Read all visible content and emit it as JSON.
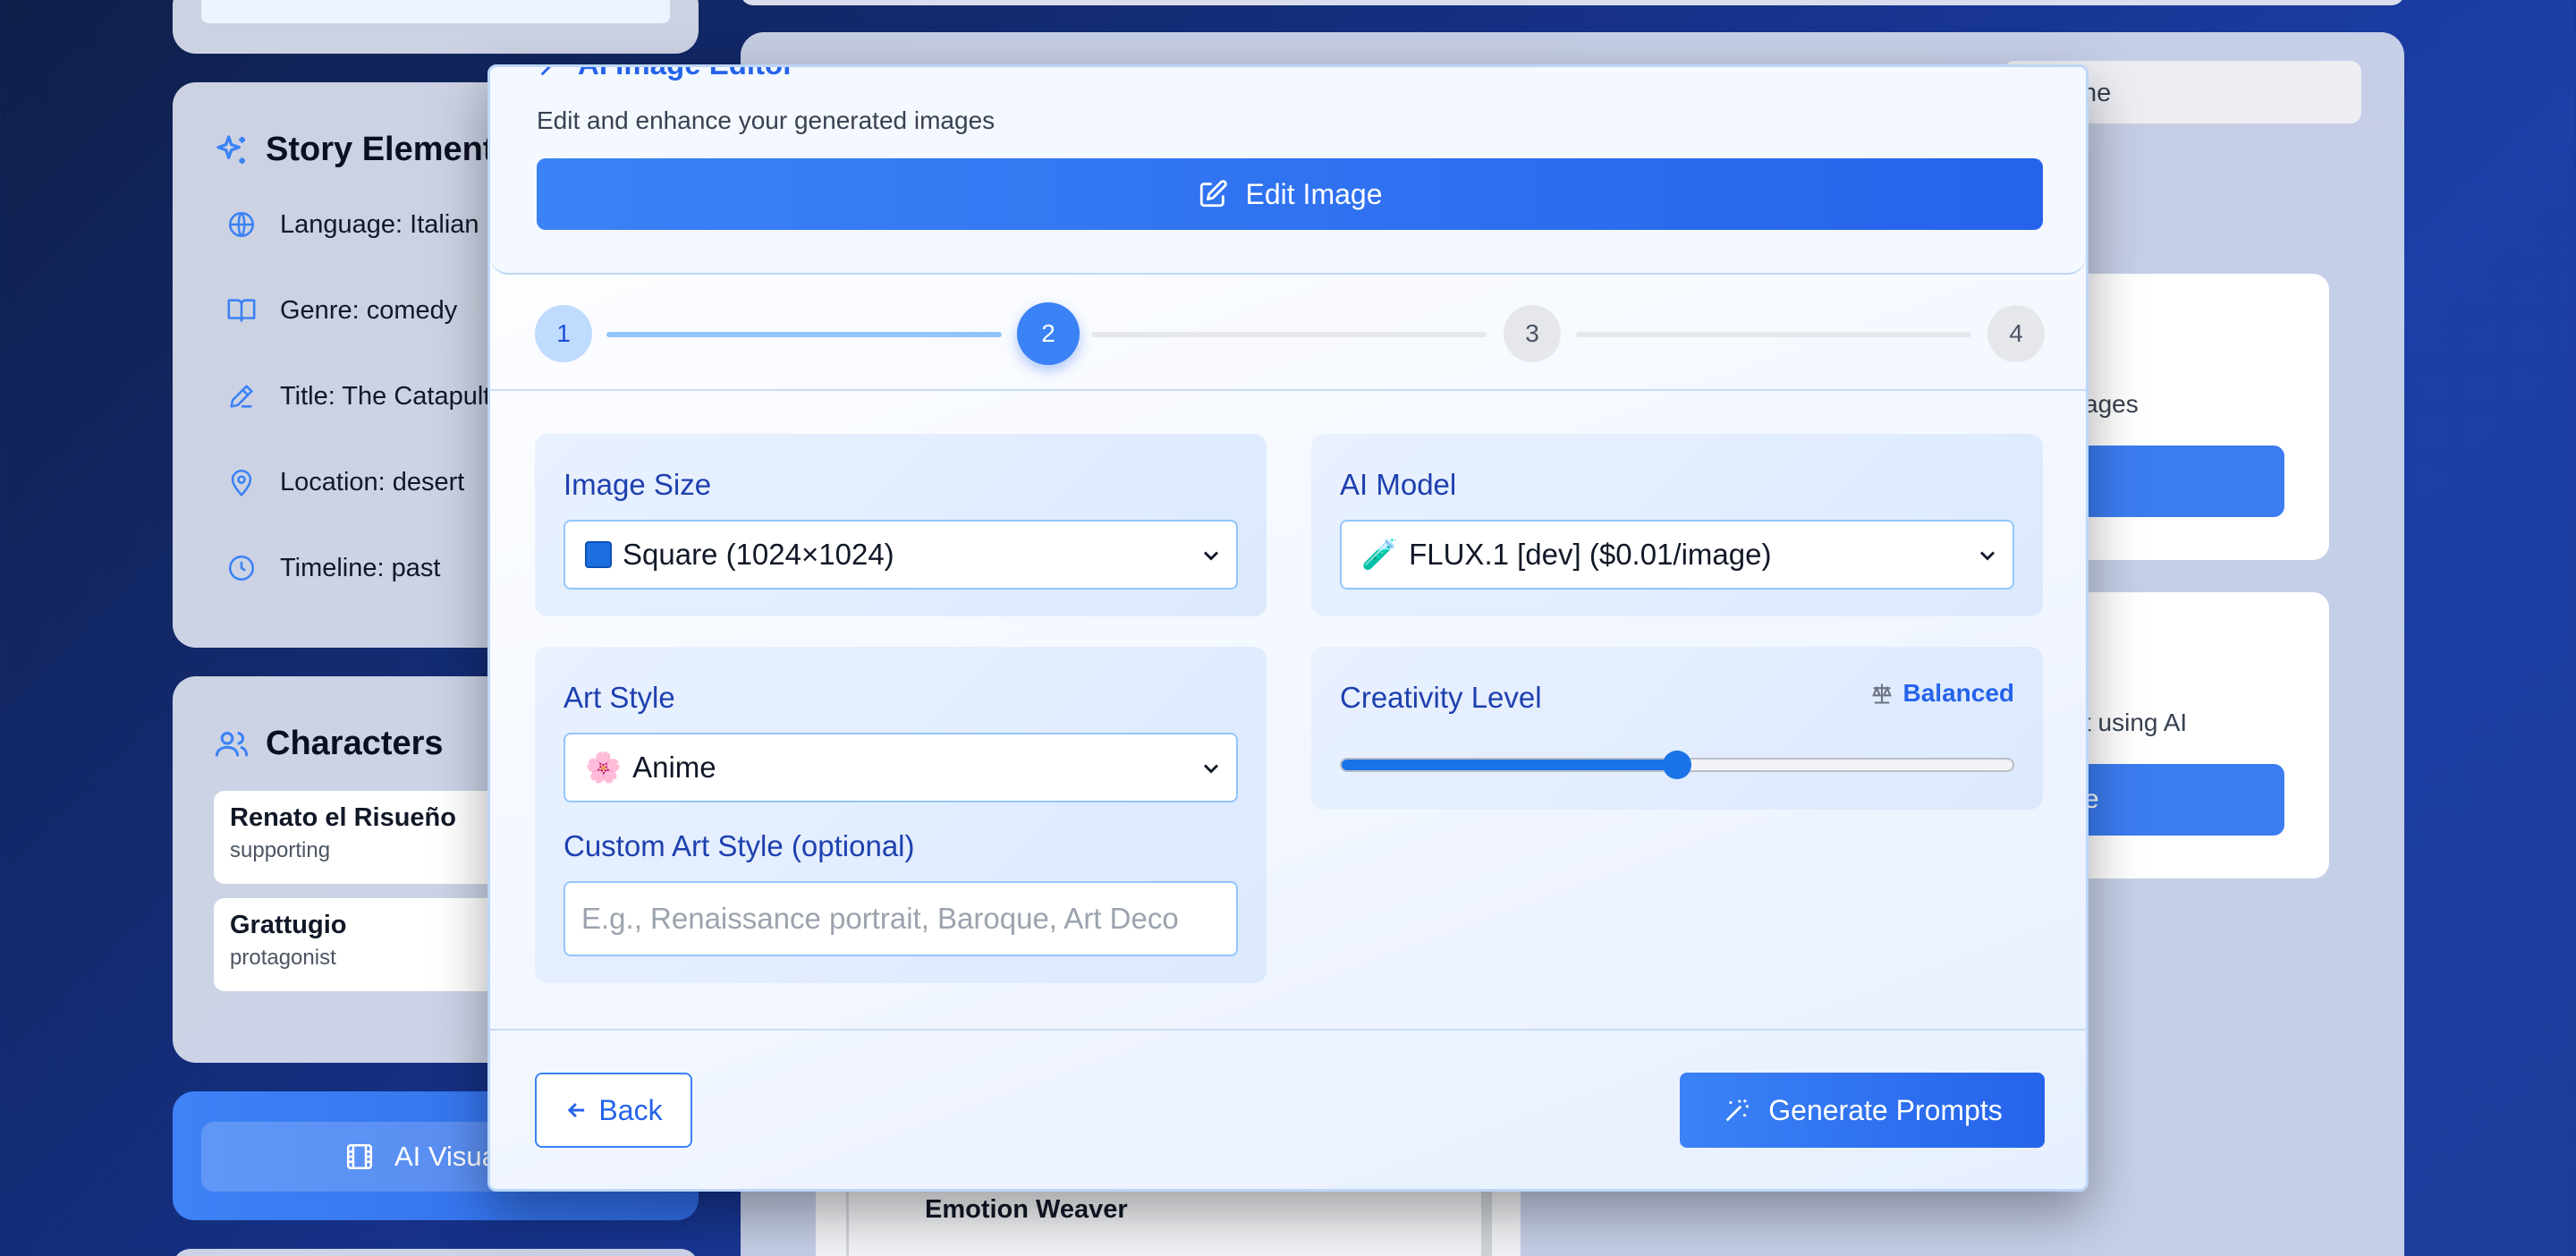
{
  "story_elements": {
    "title": "Story Elements",
    "items": [
      {
        "label": "Language: Italian"
      },
      {
        "label": "Genre: comedy"
      },
      {
        "label": "Title: The Catapult"
      },
      {
        "label": "Location: desert"
      },
      {
        "label": "Timeline: past"
      }
    ]
  },
  "characters": {
    "title": "Characters",
    "items": [
      {
        "name": "Renato el Risueño",
        "role": "supporting"
      },
      {
        "name": "Grattugio",
        "role": "protagonist"
      }
    ]
  },
  "ai_visual": {
    "label": "AI Visual S"
  },
  "background": {
    "tab_partial": "ne",
    "card1_desc": "ages",
    "card2_desc": "t using AI",
    "card2_btn": "e",
    "emotion_label": "Emotion Weaver"
  },
  "modal": {
    "title": "AI Image Editor",
    "subtitle": "Edit and enhance your generated images",
    "edit_button": "Edit Image",
    "steps": [
      {
        "number": "1",
        "state": "done"
      },
      {
        "number": "2",
        "state": "active"
      },
      {
        "number": "3",
        "state": "todo"
      },
      {
        "number": "4",
        "state": "todo"
      }
    ],
    "image_size": {
      "label": "Image Size",
      "value": "Square (1024×1024)"
    },
    "ai_model": {
      "label": "AI Model",
      "icon": "🧪",
      "value": "FLUX.1 [dev] ($0.01/image)"
    },
    "art_style": {
      "label": "Art Style",
      "icon": "🌸",
      "value": "Anime"
    },
    "custom_art_style": {
      "label": "Custom Art Style (optional)",
      "placeholder": "E.g., Renaissance portrait, Baroque, Art Deco"
    },
    "creativity": {
      "label": "Creativity Level",
      "badge": "Balanced",
      "level": 0.5
    },
    "back_button": "Back",
    "generate_button": "Generate Prompts"
  },
  "colors": {
    "accent": "#3b82f6",
    "accent_dark": "#2563eb",
    "label_blue": "#1e40af"
  }
}
